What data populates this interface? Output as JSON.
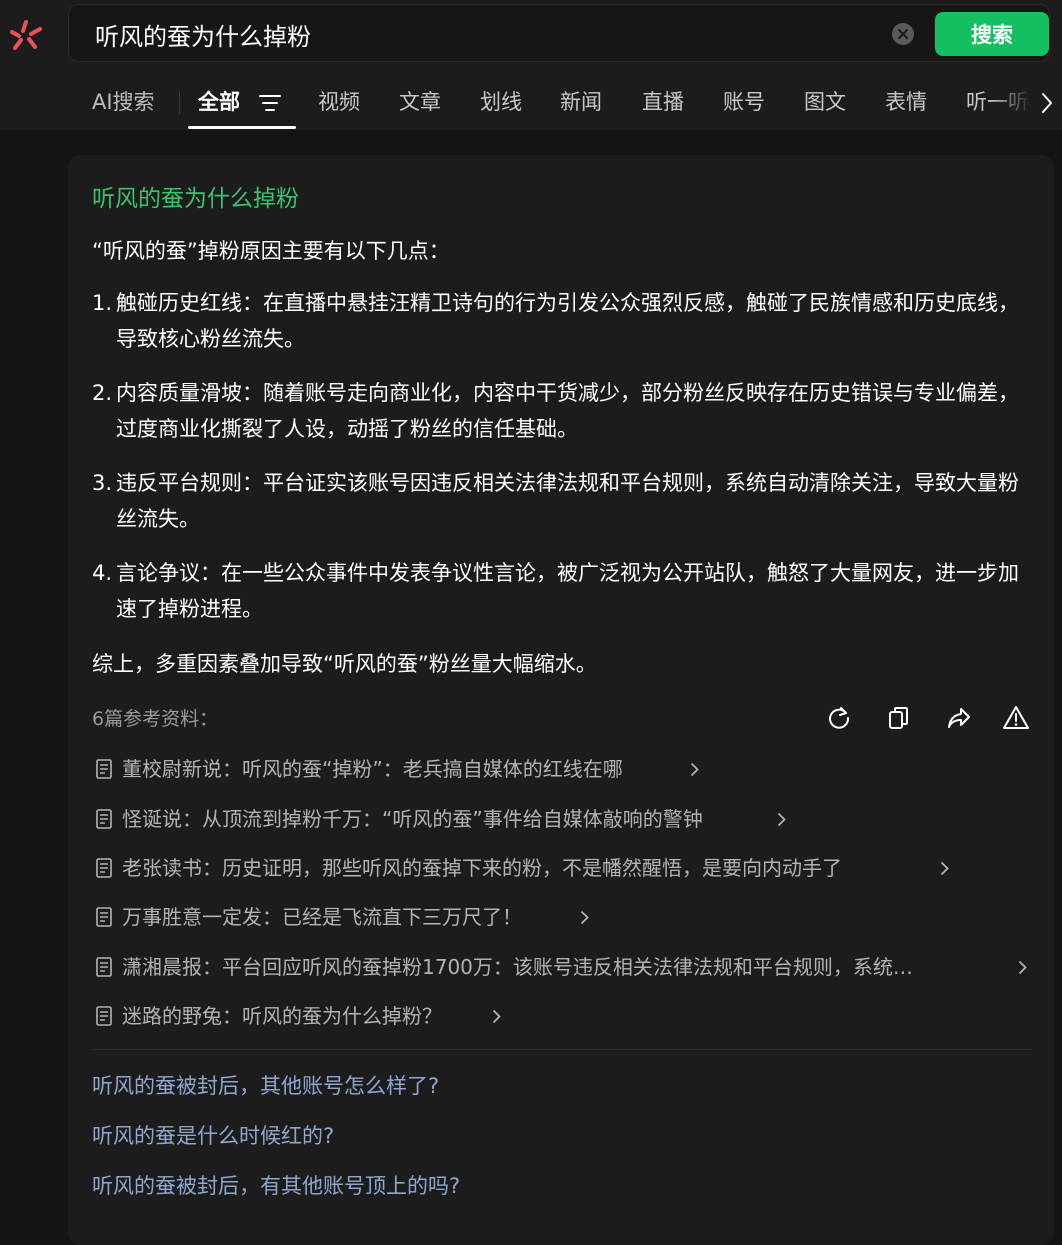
{
  "search": {
    "query": "听风的蚕为什么掉粉",
    "button_label": "搜索"
  },
  "tabs": [
    {
      "label": "AI搜索"
    },
    {
      "label": "全部"
    },
    {
      "label": "视频"
    },
    {
      "label": "文章"
    },
    {
      "label": "划线"
    },
    {
      "label": "新闻"
    },
    {
      "label": "直播"
    },
    {
      "label": "账号"
    },
    {
      "label": "图文"
    },
    {
      "label": "表情"
    },
    {
      "label": "听一听"
    }
  ],
  "answer": {
    "title": "听风的蚕为什么掉粉",
    "intro": "“听风的蚕”掉粉原因主要有以下几点：",
    "points": [
      {
        "num": "1.",
        "text": "触碰历史红线：在直播中悬挂汪精卫诗句的行为引发公众强烈反感，触碰了民族情感和历史底线，导致核心粉丝流失。"
      },
      {
        "num": "2.",
        "text": "内容质量滑坡：随着账号走向商业化，内容中干货减少，部分粉丝反映存在历史错误与专业偏差，过度商业化撕裂了人设，动摇了粉丝的信任基础。"
      },
      {
        "num": "3.",
        "text": "违反平台规则：平台证实该账号因违反相关法律法规和平台规则，系统自动清除关注，导致大量粉丝流失。"
      },
      {
        "num": "4.",
        "text": "言论争议：在一些公众事件中发表争议性言论，被广泛视为公开站队，触怒了大量网友，进一步加速了掉粉进程。"
      }
    ],
    "summary": "综上，多重因素叠加导致“听风的蚕”粉丝量大幅缩水。"
  },
  "references": {
    "title": "6篇参考资料：",
    "items": [
      {
        "text": "董校尉新说：听风的蚕“掉粉”：老兵搞自媒体的红线在哪"
      },
      {
        "text": "怪诞说：从顶流到掉粉千万：“听风的蚕”事件给自媒体敲响的警钟"
      },
      {
        "text": "老张读书：历史证明，那些听风的蚕掉下来的粉，不是幡然醒悟，是要向内动手了"
      },
      {
        "text": "万事胜意一定发：已经是飞流直下三万尺了！"
      },
      {
        "text": "潇湘晨报：平台回应听风的蚕掉粉1700万：该账号违反相关法律法规和平台规则，系统…"
      },
      {
        "text": "迷路的野兔：听风的蚕为什么掉粉？"
      }
    ]
  },
  "related_questions": [
    {
      "text": "听风的蚕被封后，其他账号怎么样了?"
    },
    {
      "text": "听风的蚕是什么时候红的?"
    },
    {
      "text": "听风的蚕被封后，有其他账号顶上的吗?"
    }
  ],
  "colors": {
    "accent_green": "#14c062",
    "title_green": "#3ac26f",
    "link_blue": "#8fa7cf",
    "background": "#141414",
    "card": "#1c1c1c"
  },
  "icons": [
    "logo-icon",
    "clear-icon",
    "filter-icon",
    "chevron-right-icon",
    "refresh-icon",
    "copy-icon",
    "share-icon",
    "warning-icon",
    "document-icon"
  ]
}
